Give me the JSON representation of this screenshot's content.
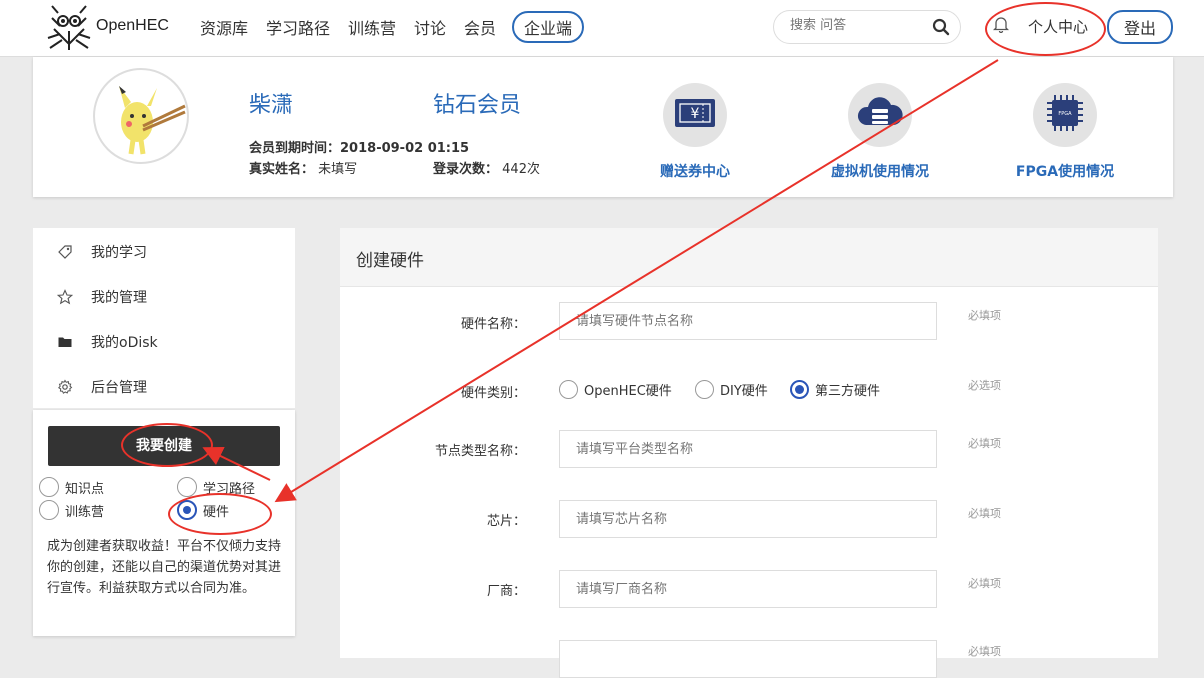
{
  "brand": {
    "name": "OpenHEC"
  },
  "nav": {
    "items": [
      "资源库",
      "学习路径",
      "训练营",
      "讨论",
      "会员"
    ],
    "enterprise": "企业端"
  },
  "search": {
    "placeholder": "搜索 问答"
  },
  "user_menu": {
    "personal_center": "个人中心",
    "logout": "登出"
  },
  "profile": {
    "username": "柴潇",
    "membership": "钻石会员",
    "expiry_label": "会员到期时间：",
    "expiry_value": "2018-09-02 01:15",
    "realname_label": "真实姓名：",
    "realname_value": "未填写",
    "login_label": "登录次数：",
    "login_value": "442次",
    "tiles": [
      {
        "label": "赠送券中心",
        "icon": "voucher-icon"
      },
      {
        "label": "虚拟机使用情况",
        "icon": "cloud-server-icon"
      },
      {
        "label": "FPGA使用情况",
        "icon": "fpga-chip-icon",
        "chip_text": "FPGA"
      }
    ]
  },
  "sidebar": {
    "items": [
      {
        "label": "我的学习",
        "icon": "tag-icon"
      },
      {
        "label": "我的管理",
        "icon": "star-icon"
      },
      {
        "label": "我的oDisk",
        "icon": "folder-icon"
      },
      {
        "label": "后台管理",
        "icon": "gear-icon"
      }
    ]
  },
  "create": {
    "button": "我要创建",
    "options": [
      {
        "label": "知识点",
        "checked": false
      },
      {
        "label": "学习路径",
        "checked": false
      },
      {
        "label": "训练营",
        "checked": false
      },
      {
        "label": "硬件",
        "checked": true
      }
    ],
    "description": "成为创建者获取收益！平台不仅倾力支持你的创建，还能以自己的渠道优势对其进行宣传。利益获取方式以合同为准。"
  },
  "form": {
    "title": "创建硬件",
    "fields": [
      {
        "label": "硬件名称：",
        "placeholder": "请填写硬件节点名称",
        "hint": "必填项"
      },
      {
        "label": "节点类型名称：",
        "placeholder": "请填写平台类型名称",
        "hint": "必填项"
      },
      {
        "label": "芯片：",
        "placeholder": "请填写芯片名称",
        "hint": "必填项"
      },
      {
        "label": "厂商：",
        "placeholder": "请填写厂商名称",
        "hint": "必填项"
      },
      {
        "label": "",
        "placeholder": "",
        "hint": "必填项"
      }
    ],
    "category": {
      "label": "硬件类别：",
      "hint": "必选项",
      "options": [
        {
          "label": "OpenHEC硬件",
          "checked": false
        },
        {
          "label": "DIY硬件",
          "checked": false
        },
        {
          "label": "第三方硬件",
          "checked": true
        }
      ]
    }
  },
  "colors": {
    "accent": "#2a6ab8",
    "annotation": "#e8322a",
    "dark_button": "#333333"
  }
}
